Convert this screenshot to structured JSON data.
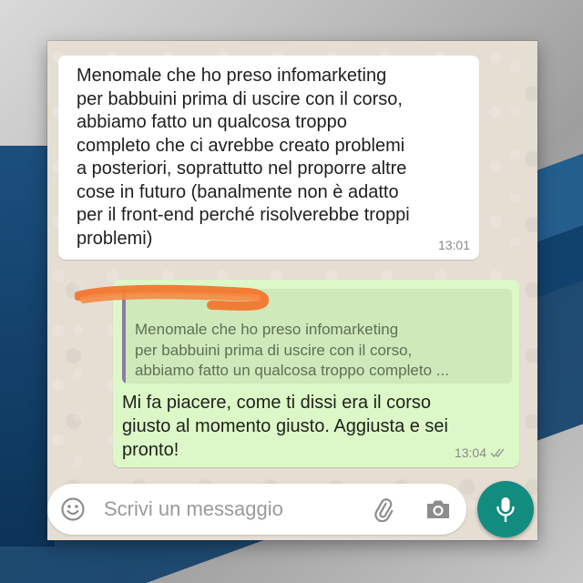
{
  "incoming": {
    "text": "Menomale che ho preso infomarketing\nper babbuini prima di uscire con il corso,\nabbiamo fatto un qualcosa troppo\ncompleto che ci avrebbe creato problemi\na posteriori, soprattutto nel proporre altre\ncose in futuro (banalmente non è adatto\nper il front-end perché risolverebbe troppi\nproblemi)",
    "time": "13:01"
  },
  "outgoing": {
    "quoted_text": "Menomale che ho preso infomarketing\nper babbuini prima di uscire con il corso,\nabbiamo fatto un qualcosa troppo completo ...",
    "text": "Mi fa piacere, come ti dissi era il corso\ngiusto al momento giusto. Aggiusta e sei\npronto!",
    "time": "13:04",
    "status_icon": "double-check-icon"
  },
  "input": {
    "placeholder": "Scrivi un messaggio"
  },
  "icons": {
    "emoji": "emoji-icon",
    "attach": "paperclip-icon",
    "camera": "camera-icon",
    "mic": "microphone-icon"
  },
  "colors": {
    "outgoing_bubble": "#dcf8c6",
    "quote_bar": "#8e7aa6",
    "mic_button": "#128c7e",
    "redaction": "#f2762e"
  }
}
